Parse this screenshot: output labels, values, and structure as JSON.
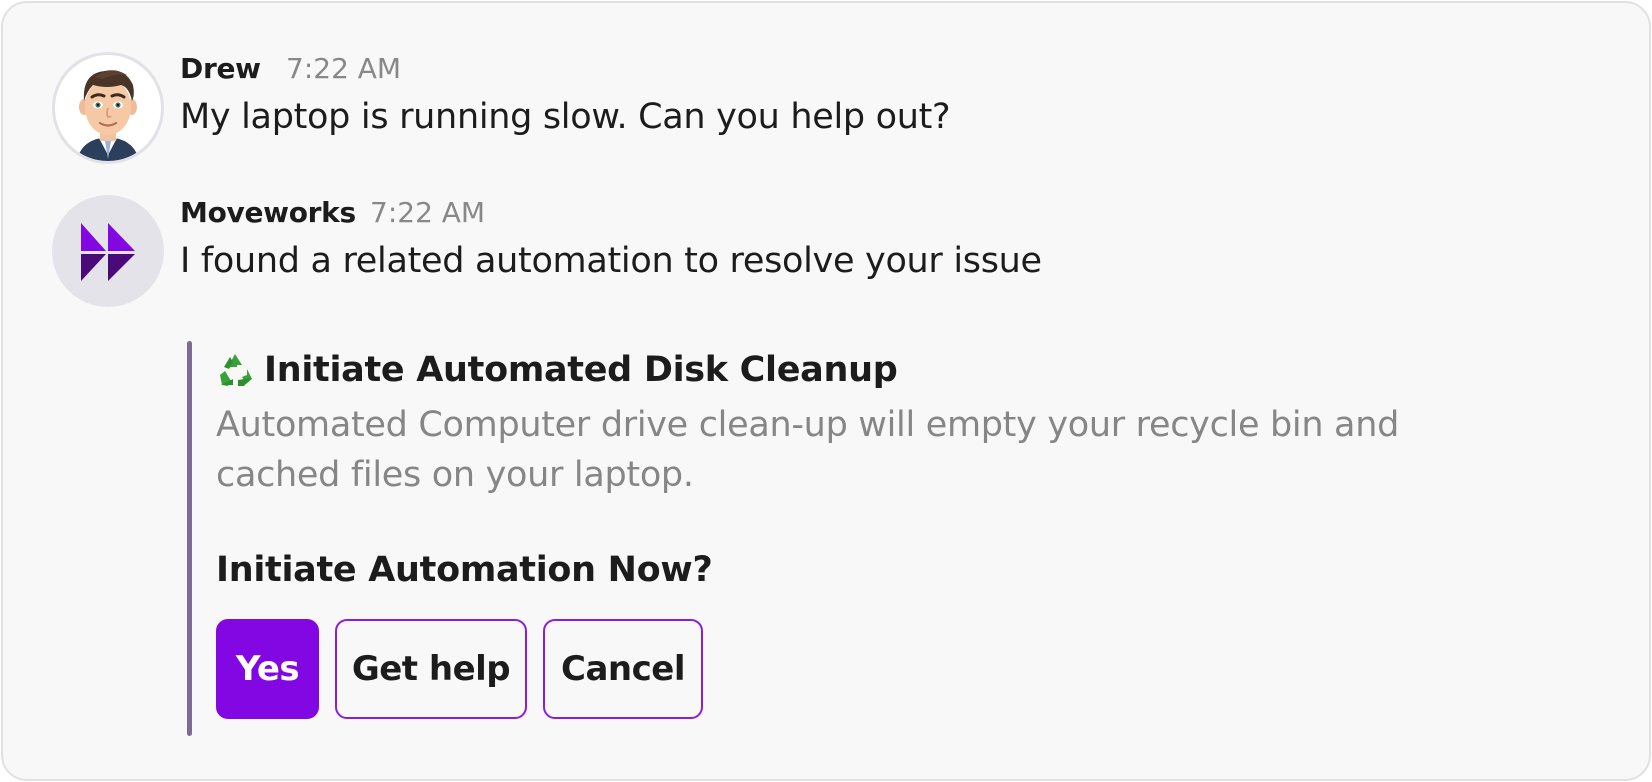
{
  "messages": [
    {
      "sender": "Drew",
      "time": "7:22 AM",
      "text": "My laptop is running slow. Can you help out?",
      "avatar_icon": "user-avatar-memoji"
    },
    {
      "sender": "Moveworks",
      "time": "7:22 AM",
      "text": "I found a related automation to resolve your issue",
      "avatar_icon": "moveworks-logo"
    }
  ],
  "attachment": {
    "icon": "recycle-icon",
    "title": "Initiate Automated Disk Cleanup",
    "description": "Automated Computer drive clean-up will empty your recycle bin and cached files on your laptop.",
    "question": "Initiate Automation Now?",
    "buttons": {
      "yes": "Yes",
      "get_help": "Get help",
      "cancel": "Cancel"
    }
  },
  "colors": {
    "accent": "#8207e3",
    "attachment_bar": "#7d6a95",
    "background": "#f8f8f8",
    "muted_text": "#868686"
  }
}
